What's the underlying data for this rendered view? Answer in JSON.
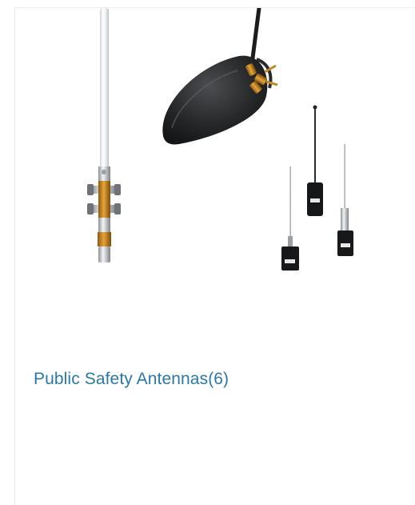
{
  "category_card": {
    "name": "Public Safety Antennas",
    "count": "(6)",
    "image_icon": "antennas-product-image",
    "link_color": "#2a78a8"
  }
}
